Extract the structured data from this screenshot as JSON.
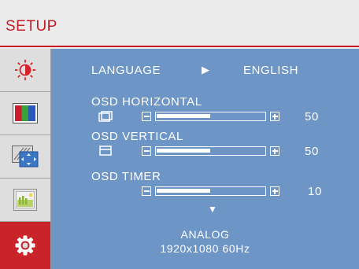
{
  "header": {
    "title": "SETUP"
  },
  "sidebar": {
    "items": [
      {
        "icon": "brightness-icon",
        "active": false
      },
      {
        "icon": "color-bars-icon",
        "active": false
      },
      {
        "icon": "image-position-icon",
        "active": false
      },
      {
        "icon": "picture-icon",
        "active": false
      },
      {
        "icon": "gear-icon",
        "active": true
      }
    ]
  },
  "main": {
    "language": {
      "label": "LANGUAGE",
      "arrow": "▶",
      "value": "ENGLISH"
    },
    "osd_horizontal": {
      "label": "OSD  HORIZONTAL",
      "value": "50",
      "level": 0.5,
      "icon": "osd-horizontal-icon"
    },
    "osd_vertical": {
      "label": "OSD  VERTICAL",
      "value": "50",
      "level": 0.5,
      "icon": "osd-vertical-icon"
    },
    "osd_timer": {
      "label": "OSD  TIMER",
      "value": "10",
      "level": 0.5
    },
    "more_indicator": "▼",
    "signal": {
      "source": "ANALOG",
      "resolution": "1920x1080  60Hz"
    }
  },
  "colors": {
    "accent": "#c8242a",
    "panel": "#6d95c6",
    "sidebar": "#dedede",
    "text": "#ffffff"
  }
}
